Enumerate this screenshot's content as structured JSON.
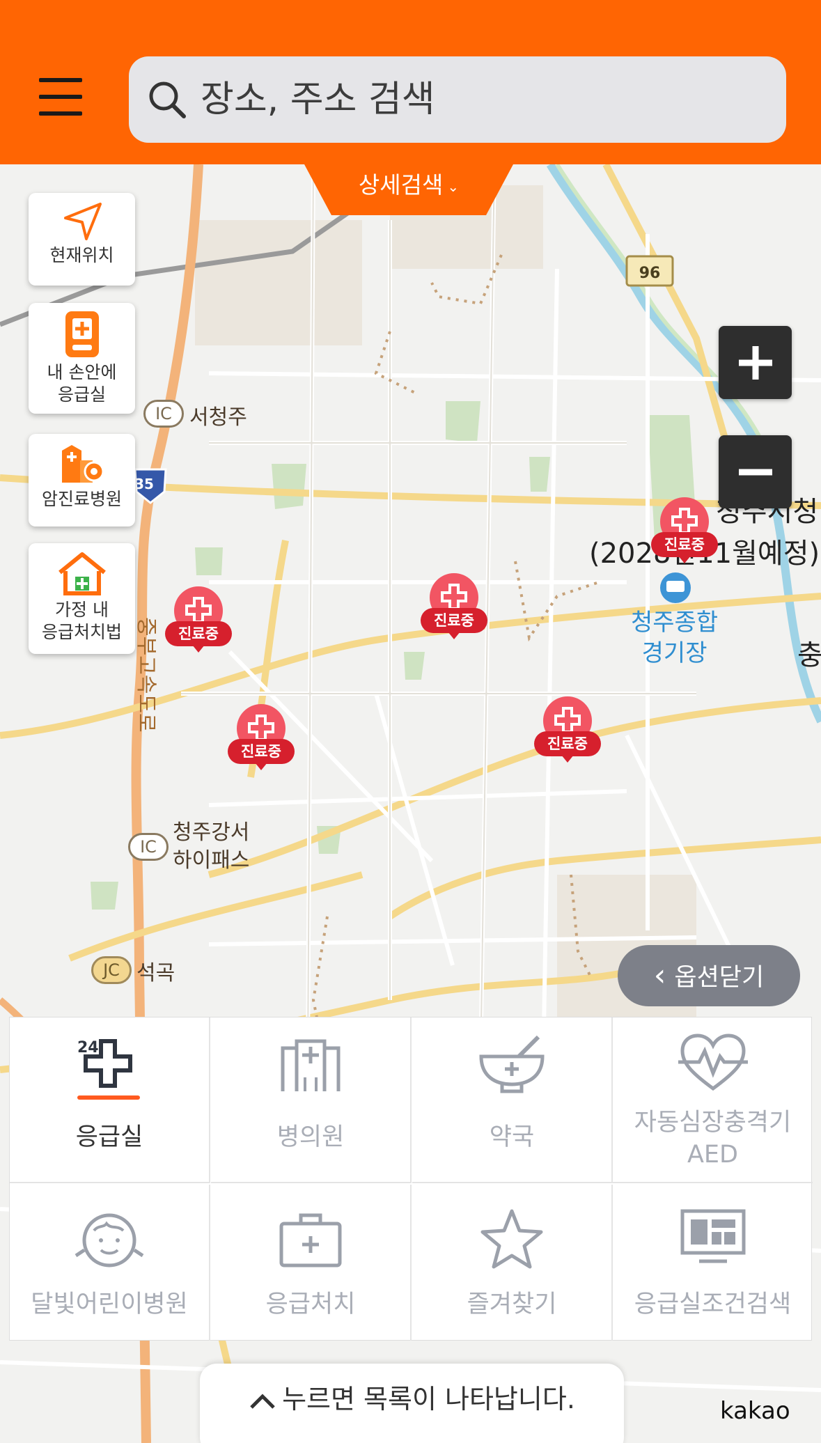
{
  "header": {
    "search_placeholder": "장소, 주소 검색"
  },
  "detail_search": {
    "label": "상세검색",
    "chevron": "⌄"
  },
  "side_buttons": [
    {
      "label": "현재위치",
      "icon": "location-arrow-icon"
    },
    {
      "label": "내 손안에\n응급실",
      "label_line1": "내 손안에",
      "label_line2": "응급실",
      "icon": "phone-emergency-icon"
    },
    {
      "label": "암진료병원",
      "icon": "cancer-hospital-icon"
    },
    {
      "label_line1": "가정 내",
      "label_line2": "응급처치법",
      "icon": "home-firstaid-icon"
    }
  ],
  "zoom": {
    "in": "+",
    "out": "−"
  },
  "map_labels": {
    "seocheongju": "서청주",
    "ic": "IC",
    "jc": "JC",
    "cheongju_gangseo_1": "청주강서",
    "cheongju_gangseo_2": "하이패스",
    "seokgok": "석곡",
    "city_hall_1": "청주시청",
    "city_hall_2": "(2028년11월예정)",
    "stadium_1": "청주종합",
    "stadium_2": "경기장",
    "route_96": "96",
    "route_35": "35",
    "expressway": "중부고속도로",
    "edge_char": "충"
  },
  "markers": [
    {
      "status": "진료중"
    },
    {
      "status": "진료중"
    },
    {
      "status": "진료중"
    },
    {
      "status": "진료중"
    },
    {
      "status": "진료중"
    }
  ],
  "option_close": {
    "label": "옵션닫기",
    "chevron": "‹"
  },
  "categories": [
    {
      "label": "응급실",
      "icon": "emergency-24-icon",
      "active": true,
      "badge": "24"
    },
    {
      "label": "병의원",
      "icon": "hospital-icon",
      "active": false
    },
    {
      "label": "약국",
      "icon": "pharmacy-icon",
      "active": false
    },
    {
      "label_line1": "자동심장충격기",
      "label_line2": "AED",
      "icon": "heart-pulse-icon",
      "active": false
    },
    {
      "label": "달빛어린이병원",
      "icon": "child-face-icon",
      "active": false
    },
    {
      "label": "응급처치",
      "icon": "first-aid-kit-icon",
      "active": false
    },
    {
      "label": "즐겨찾기",
      "icon": "star-icon",
      "active": false
    },
    {
      "label": "응급실조건검색",
      "icon": "monitor-icon",
      "active": false
    }
  ],
  "bottom_bar": {
    "label": "누르면 목록이 나타납니다.",
    "chevron": "^"
  },
  "brand": {
    "label": "kakao"
  },
  "colors": {
    "accent": "#ff6503",
    "marker": "#f25563",
    "marker_tag": "#d6202d",
    "inactive_text": "#a9adb6"
  }
}
